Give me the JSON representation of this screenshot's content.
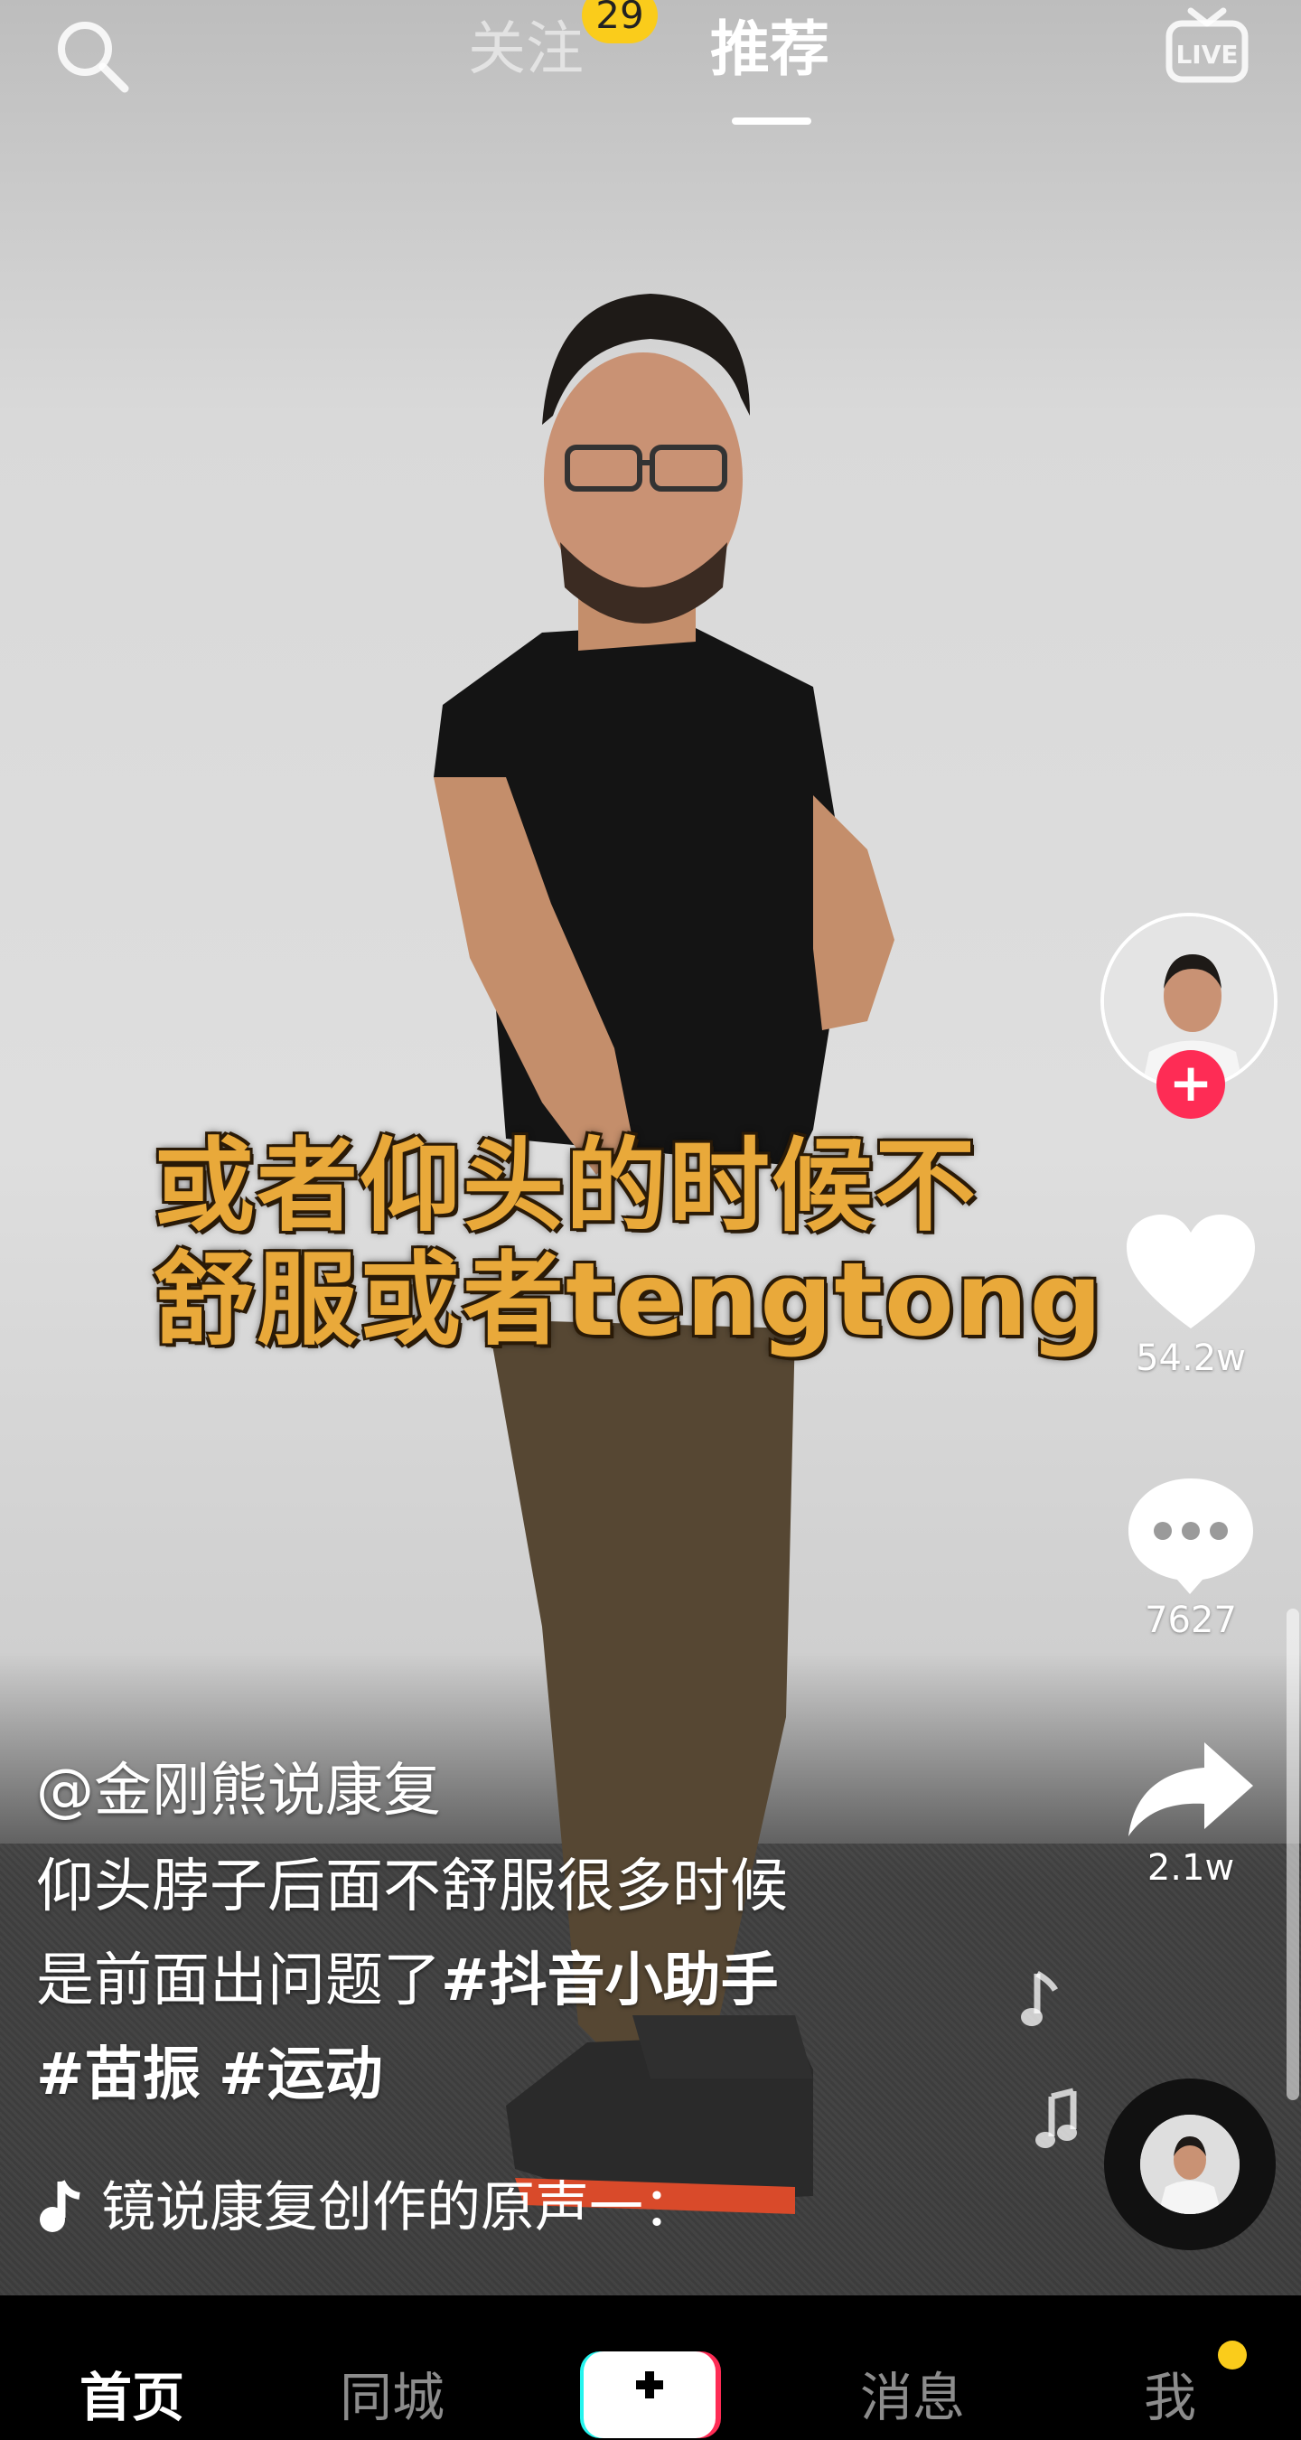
{
  "header": {
    "tab_follow": "关注",
    "follow_badge": "29",
    "tab_recommend": "推荐"
  },
  "video": {
    "subtitle_line1": "或者仰头的时候不",
    "subtitle_line2": "舒服或者tengtong"
  },
  "rail": {
    "like_count": "54.2w",
    "comment_count": "7627",
    "share_count": "2.1w"
  },
  "caption": {
    "author": "@金刚熊说康复",
    "desc_line1": "仰头脖子后面不舒服很多时候",
    "desc_line2_plain": "是前面出问题了",
    "tag1": "#抖音小助手",
    "tag2": "#苗振",
    "tag3": "#运动",
    "music": "镜说康复创作的原声一："
  },
  "nav": {
    "home": "首页",
    "city": "同城",
    "messages": "消息",
    "me": "我"
  },
  "colors": {
    "accent_red": "#fe2c55",
    "badge_yellow": "#facc1b",
    "subtitle": "#e9a93a"
  }
}
